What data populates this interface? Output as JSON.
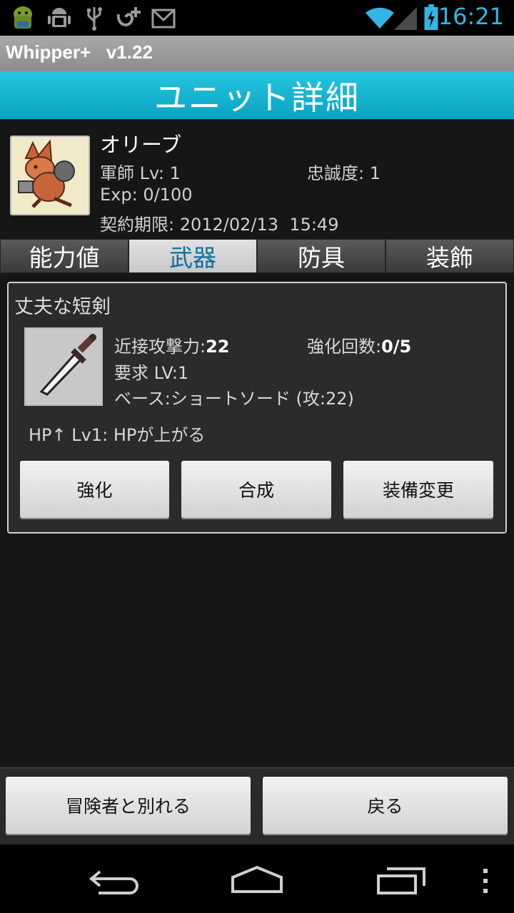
{
  "status_bar": {
    "time": "16:21",
    "icons_left": [
      "android-icon",
      "debug-icon",
      "usb-icon",
      "sync-icon",
      "gmail-icon"
    ],
    "icons_right": [
      "wifi-icon",
      "signal-icon",
      "battery-charging-icon"
    ],
    "accent": "#33b5e5"
  },
  "app": {
    "title": "Whipper+   v1.22"
  },
  "header": {
    "title": "ユニット詳細",
    "color": "#1ab4d0"
  },
  "unit": {
    "name": "オリーブ",
    "class_level": "軍師 Lv: 1",
    "loyalty": "忠誠度: 1",
    "exp": "Exp: 0/100",
    "contract": "契約期限: 2012/02/13  15:49"
  },
  "tabs": [
    {
      "label": "能力値",
      "active": false
    },
    {
      "label": "武器",
      "active": true
    },
    {
      "label": "防具",
      "active": false
    },
    {
      "label": "装飾",
      "active": false
    }
  ],
  "weapon": {
    "name": "丈夫な短剣",
    "attack_label": "近接攻撃力:",
    "attack_value": "22",
    "enhance_label": "強化回数:",
    "enhance_value": "0/5",
    "requirement": "要求 LV:1",
    "base": "ベース:ショートソード (攻:22)",
    "effect": "HP↑ Lv1: HPが上がる",
    "buttons": {
      "enhance": "強化",
      "synthesize": "合成",
      "change": "装備変更"
    }
  },
  "bottom": {
    "leave_label": "冒険者と別れる",
    "back_label": "戻る"
  },
  "nav": {
    "icons": [
      "back-icon",
      "home-icon",
      "recent-apps-icon",
      "overflow-menu-icon"
    ]
  }
}
